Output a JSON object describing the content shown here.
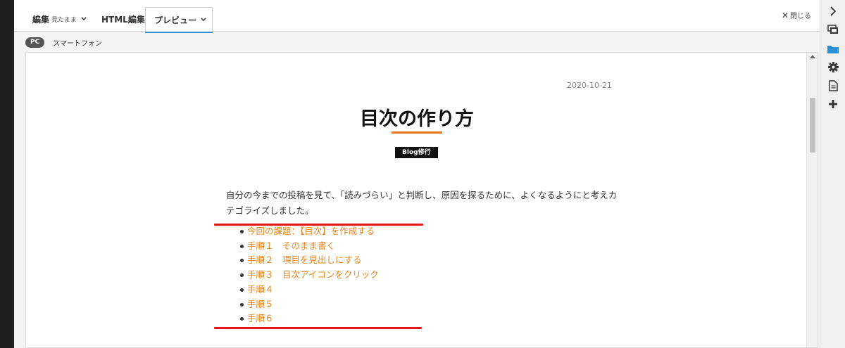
{
  "tabs": {
    "edit_label": "編集",
    "edit_sub": "見たまま",
    "html_label": "HTML編集",
    "preview_label": "プレビュー",
    "close_label": "閉じる"
  },
  "devices": {
    "pc_label": "PC",
    "smartphone_label": "スマートフォン"
  },
  "article": {
    "date": "2020-10-21",
    "title": "目次の作り方",
    "category": "Blog修行",
    "intro": "自分の今までの投稿を見て、「読みづらい」と判断し、原因を探るために、よくなるようにと考えカテゴライズしました。",
    "toc": [
      "今回の課題：【目次】を作成する",
      "手順１　そのまま書く",
      "手順２　項目を見出しにする",
      "手順３　目次アイコンをクリック",
      "手順４",
      "手順５",
      "手順６"
    ]
  },
  "colors": {
    "accent_orange": "#e8851d",
    "underline_orange": "#e8731c",
    "red_annotation": "#e41414",
    "tab_active_blue": "#2e8fd6",
    "folder_blue": "#2e8fd6"
  },
  "icons": {
    "sidebar": [
      "chevron-right-icon",
      "preview-icon",
      "folder-icon",
      "gear-icon",
      "document-icon",
      "plus-icon"
    ]
  }
}
